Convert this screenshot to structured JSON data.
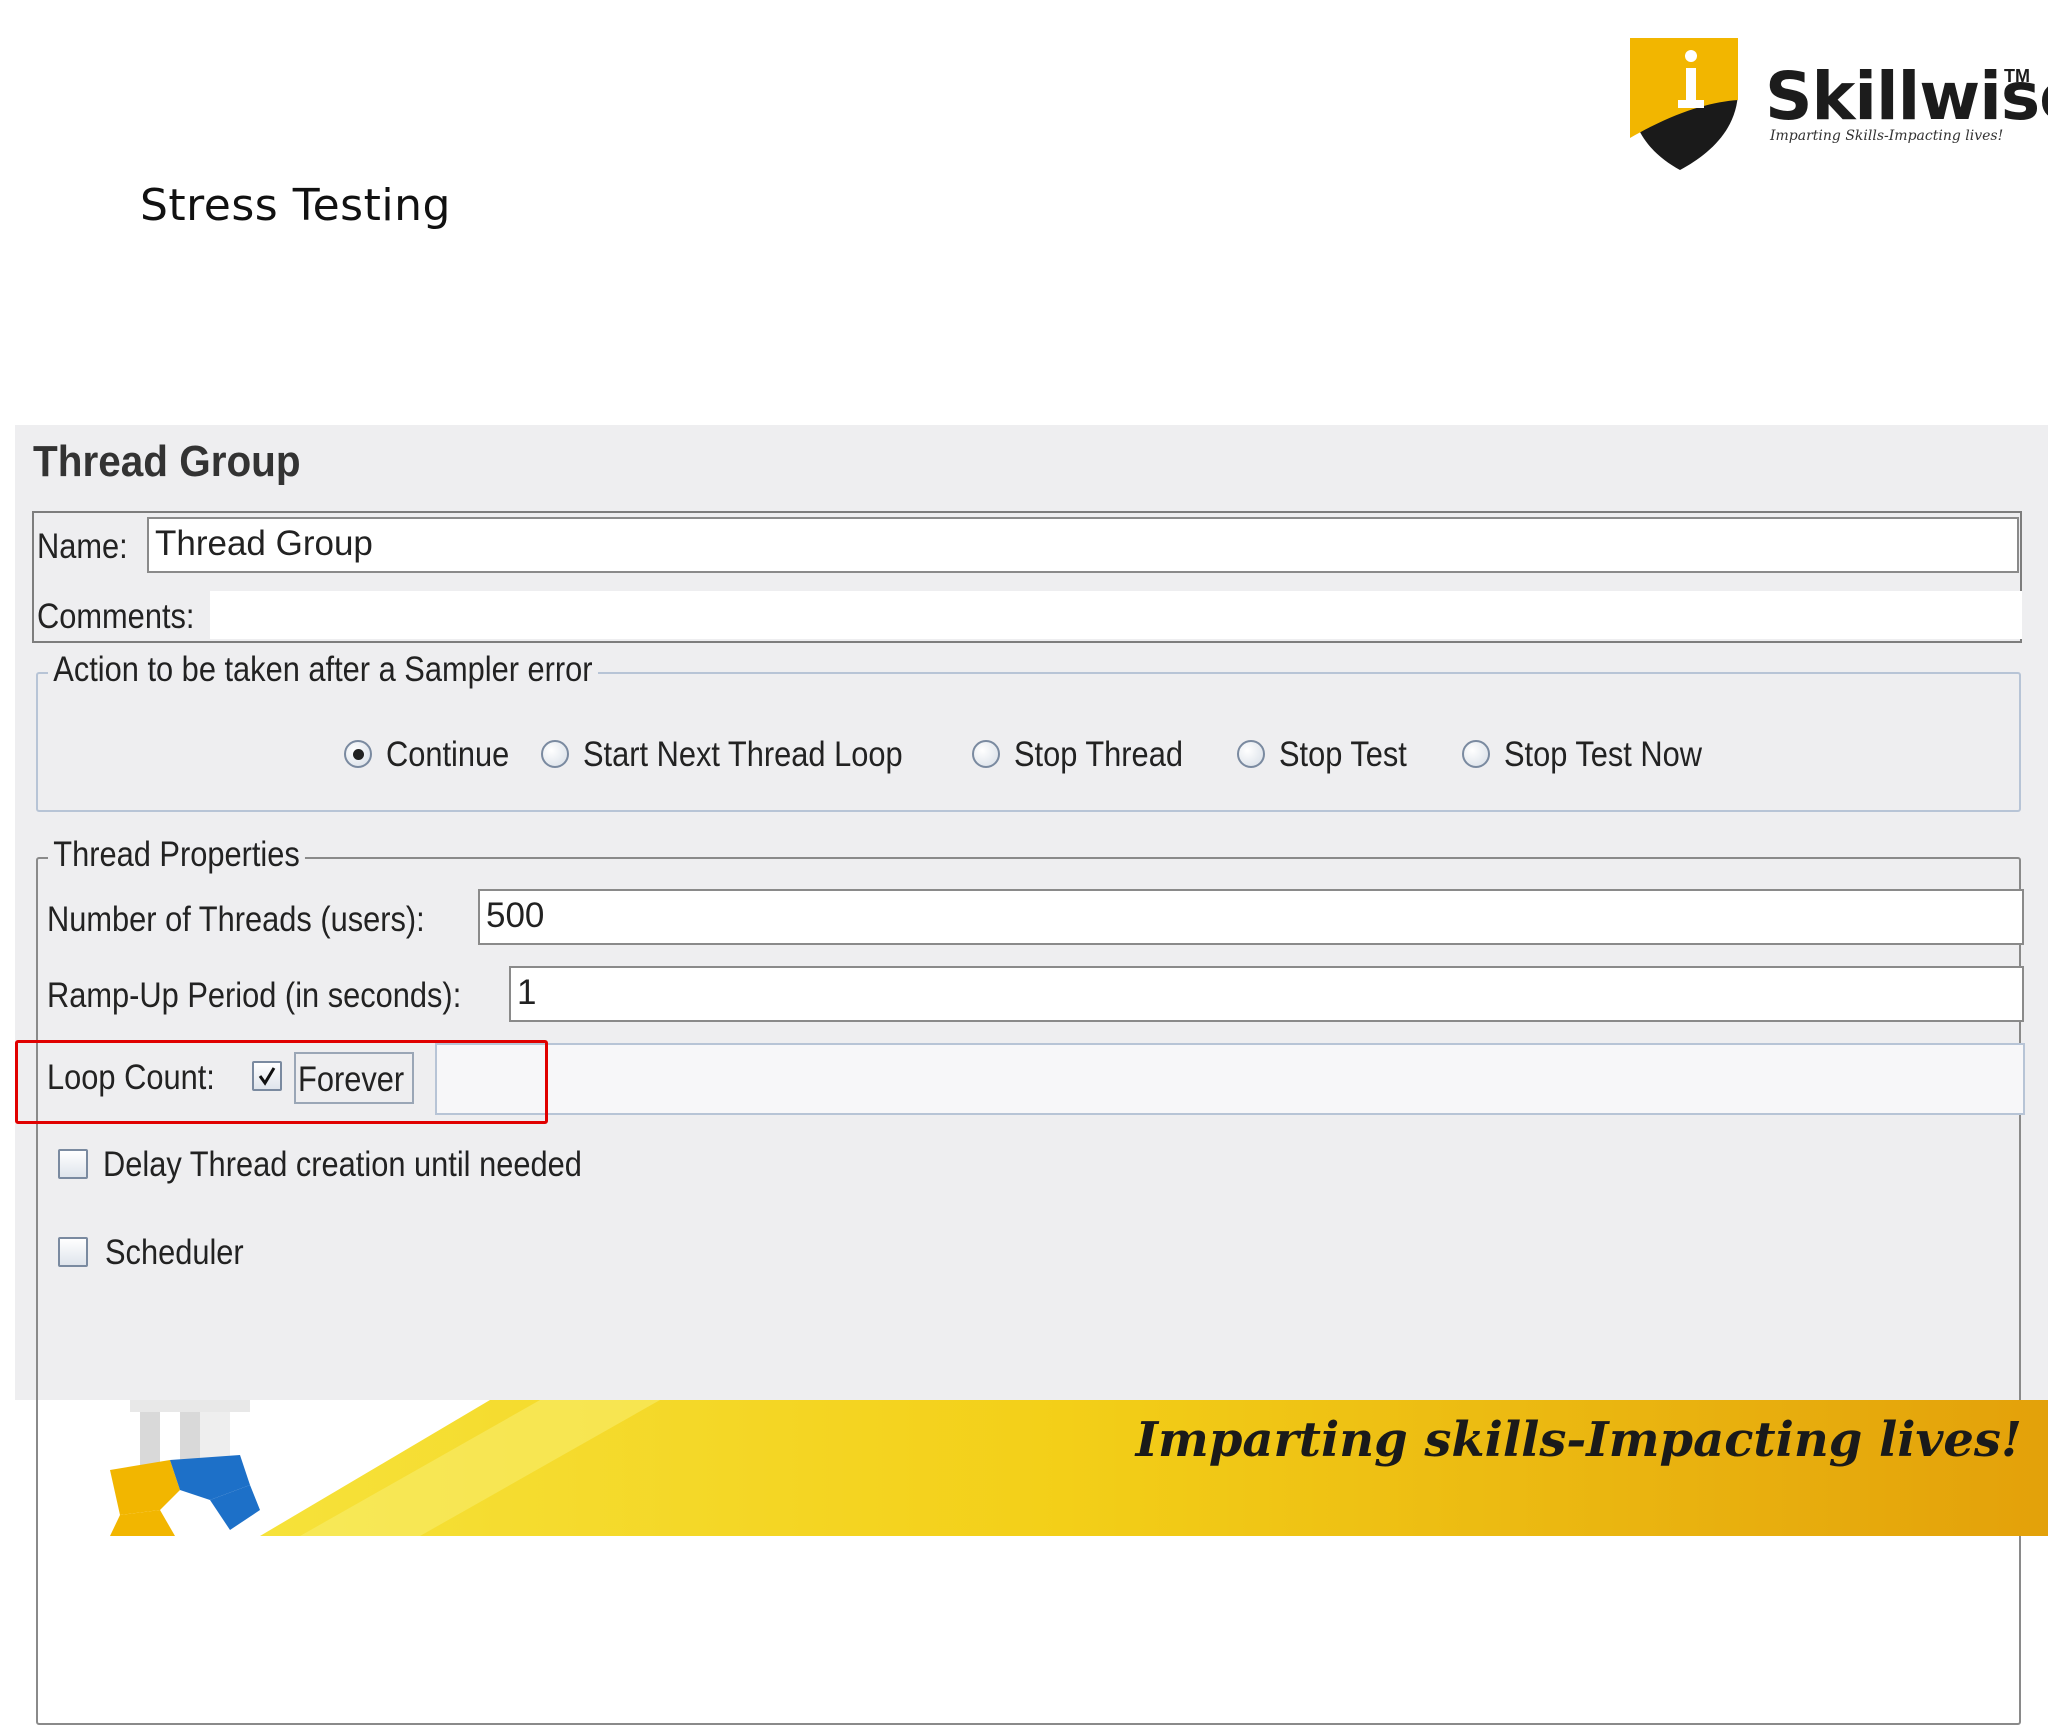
{
  "slide": {
    "title": "Stress Testing",
    "tagline": "Imparting skills-Impacting lives!"
  },
  "logo": {
    "name": "Skillwise",
    "trademark": "TM",
    "tagline": "Imparting Skills-Impacting lives!"
  },
  "thread_group": {
    "title": "Thread Group",
    "name_label": "Name:",
    "name_value": "Thread Group",
    "comments_label": "Comments:",
    "comments_value": "",
    "sampler_error": {
      "legend": "Action to be taken after a Sampler error",
      "options": [
        {
          "label": "Continue",
          "selected": true
        },
        {
          "label": "Start Next Thread Loop",
          "selected": false
        },
        {
          "label": "Stop Thread",
          "selected": false
        },
        {
          "label": "Stop Test",
          "selected": false
        },
        {
          "label": "Stop Test Now",
          "selected": false
        }
      ]
    },
    "thread_properties": {
      "legend": "Thread Properties",
      "threads_label": "Number of Threads (users):",
      "threads_value": "500",
      "rampup_label": "Ramp-Up Period (in seconds):",
      "rampup_value": "1",
      "loop_label": "Loop Count:",
      "forever_label": "Forever",
      "forever_checked": true,
      "loop_value": "",
      "delay_label": "Delay Thread creation until needed",
      "delay_checked": false,
      "scheduler_label": "Scheduler",
      "scheduler_checked": false
    }
  },
  "colors": {
    "highlight": "#e00000",
    "panel_bg": "#eeeef0",
    "footer_yellow": "#f1c40f"
  },
  "icons": {
    "logo": "shield-logo-icon",
    "footer": "puzzle-figure-icon"
  }
}
